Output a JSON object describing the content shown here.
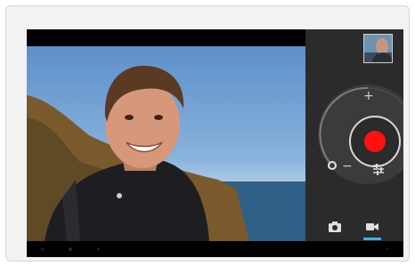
{
  "camera": {
    "shutter_label": "",
    "zoom_in_symbol": "+",
    "zoom_out_symbol": "−"
  },
  "modes": [
    {
      "name": "camera-mode",
      "icon": "camera-icon",
      "active": false
    },
    {
      "name": "video-mode",
      "icon": "video-camera-icon",
      "active": true
    }
  ],
  "colors": {
    "record": "#ff1111",
    "panel": "#2b2b2b",
    "accent": "#33b5e5"
  },
  "icons": {
    "settings": "sliders-icon",
    "thumbnail": "last-capture-thumbnail"
  }
}
